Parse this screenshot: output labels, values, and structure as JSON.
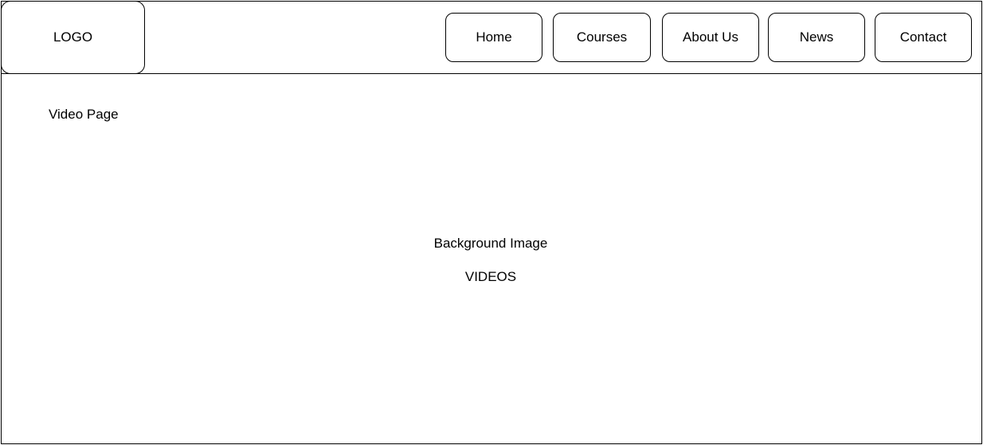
{
  "header": {
    "logo_text": "LOGO",
    "nav": [
      {
        "label": "Home"
      },
      {
        "label": "Courses"
      },
      {
        "label": "About Us"
      },
      {
        "label": "News"
      },
      {
        "label": "Contact"
      }
    ]
  },
  "main": {
    "page_label": "Video Page",
    "background_label": "Background Image",
    "videos_label": "VIDEOS"
  }
}
